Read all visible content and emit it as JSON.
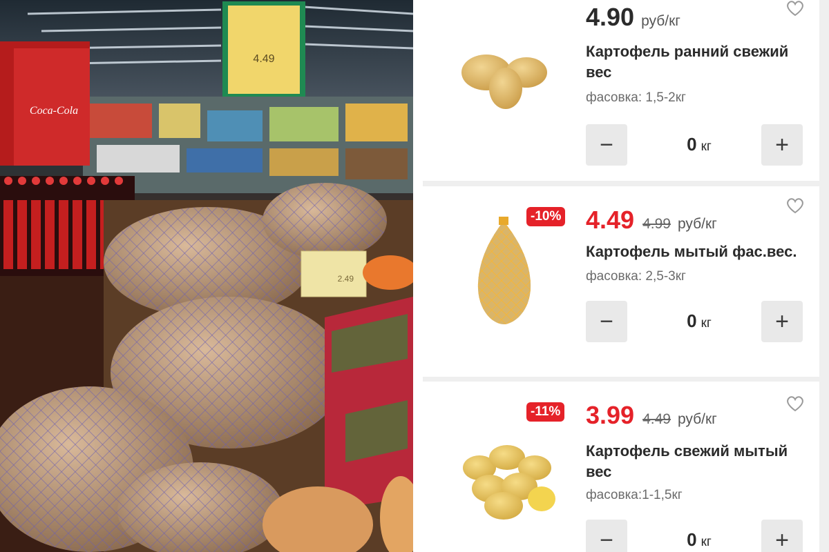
{
  "photo": {
    "sign_price": "4.49",
    "shelf_tag_price": "2.49",
    "brand_text": "Coca-Cola"
  },
  "products": [
    {
      "price": "4.90",
      "old_price": "",
      "discount": "",
      "unit": "руб/кг",
      "title": "Картофель ранний свежий вес",
      "packaging": "фасовка: 1,5-2кг",
      "qty_value": "0",
      "qty_unit": "кг",
      "sale": false
    },
    {
      "price": "4.49",
      "old_price": "4.99",
      "discount": "-10%",
      "unit": "руб/кг",
      "title": "Картофель мытый фас.вес.",
      "packaging": "фасовка: 2,5-3кг",
      "qty_value": "0",
      "qty_unit": "кг",
      "sale": true
    },
    {
      "price": "3.99",
      "old_price": "4.49",
      "discount": "-11%",
      "unit": "руб/кг",
      "title": "Картофель свежий мытый вес",
      "packaging": "фасовка:1-1,5кг",
      "qty_value": "0",
      "qty_unit": "кг",
      "sale": true
    }
  ],
  "controls": {
    "minus_symbol": "−",
    "plus_symbol": "+"
  },
  "icons": {
    "favorite": "heart-outline-icon",
    "decrease": "minus-icon",
    "increase": "plus-icon"
  },
  "colors": {
    "sale_red": "#e52229",
    "text_dark": "#2b2b2b",
    "button_gray": "#e9e9e9"
  }
}
